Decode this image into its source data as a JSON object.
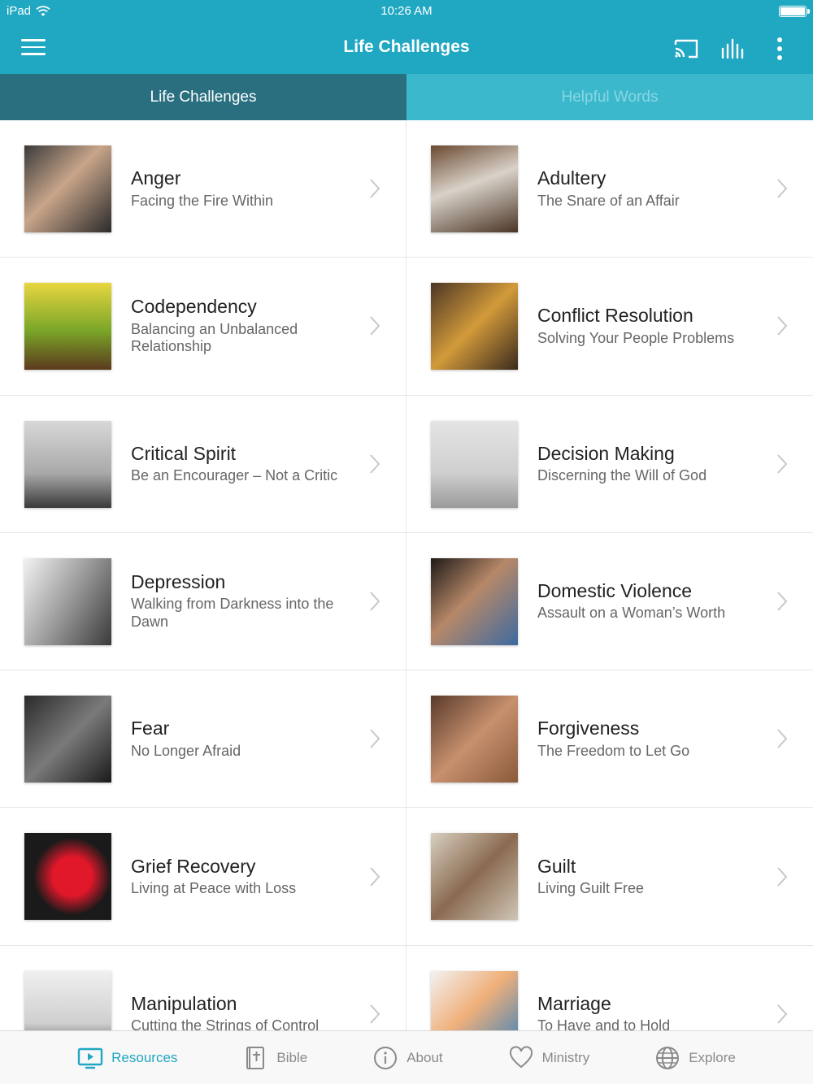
{
  "status": {
    "carrier": "iPad",
    "time": "10:26 AM"
  },
  "header": {
    "title": "Life Challenges"
  },
  "tabs": [
    {
      "label": "Life Challenges"
    },
    {
      "label": "Helpful Words"
    }
  ],
  "topics": [
    {
      "title": "Anger",
      "subtitle": "Facing the Fire Within"
    },
    {
      "title": "Adultery",
      "subtitle": "The Snare of an Affair"
    },
    {
      "title": "Codependency",
      "subtitle": "Balancing an Unbalanced Relationship"
    },
    {
      "title": "Conflict Resolution",
      "subtitle": "Solving Your People Problems"
    },
    {
      "title": "Critical Spirit",
      "subtitle": "Be an Encourager – Not a Critic"
    },
    {
      "title": "Decision Making",
      "subtitle": "Discerning the Will of God"
    },
    {
      "title": "Depression",
      "subtitle": "Walking from Darkness into the Dawn"
    },
    {
      "title": "Domestic Violence",
      "subtitle": "Assault on a Woman’s Worth"
    },
    {
      "title": "Fear",
      "subtitle": "No Longer Afraid"
    },
    {
      "title": "Forgiveness",
      "subtitle": "The Freedom to Let Go"
    },
    {
      "title": "Grief Recovery",
      "subtitle": "Living at Peace with Loss"
    },
    {
      "title": "Guilt",
      "subtitle": "Living Guilt Free"
    },
    {
      "title": "Manipulation",
      "subtitle": "Cutting the Strings of Control"
    },
    {
      "title": "Marriage",
      "subtitle": "To Have and to Hold"
    }
  ],
  "bottom_nav": [
    {
      "label": "Resources"
    },
    {
      "label": "Bible"
    },
    {
      "label": "About"
    },
    {
      "label": "Ministry"
    },
    {
      "label": "Explore"
    }
  ],
  "colors": {
    "accent": "#20a7c2",
    "active_tab": "#2a6f7f",
    "inactive_tab": "#3cb8cd"
  }
}
